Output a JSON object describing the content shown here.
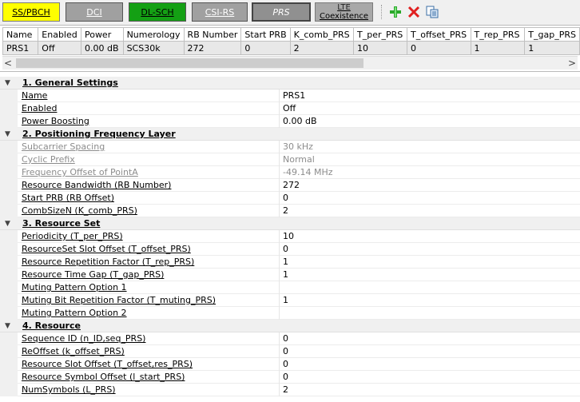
{
  "tabs": [
    {
      "label": "SS/PBCH"
    },
    {
      "label": "DCI"
    },
    {
      "label": "DL-SCH"
    },
    {
      "label": "CSI-RS"
    },
    {
      "label": "PRS"
    },
    {
      "label_line1": "LTE",
      "label_line2": "Coexistence"
    }
  ],
  "toolbar": {
    "add_icon": "add-plus-icon",
    "delete_icon": "delete-x-icon",
    "copy_icon": "copy-icon",
    "colors": {
      "add": "#2aa82a",
      "delete": "#e02020"
    }
  },
  "grid": {
    "columns": [
      "Name",
      "Enabled",
      "Power",
      "Numerology",
      "RB Number",
      "Start PRB",
      "K_comb_PRS",
      "T_per_PRS",
      "T_offset_PRS",
      "T_rep_PRS",
      "T_gap_PRS"
    ],
    "rows": [
      [
        "PRS1",
        "Off",
        "0.00 dB",
        "SCS30k",
        "272",
        "0",
        "2",
        "10",
        "0",
        "1",
        "1"
      ]
    ],
    "scroll_left": "<",
    "scroll_right": ">"
  },
  "sections": [
    {
      "title": "1. General Settings",
      "toggle": "▼",
      "props": [
        {
          "name": "Name",
          "value": "PRS1",
          "disabled": false
        },
        {
          "name": "Enabled",
          "value": "Off",
          "disabled": false
        },
        {
          "name": "Power Boosting",
          "value": "0.00 dB",
          "disabled": false
        }
      ]
    },
    {
      "title": "2. Positioning Frequency Layer",
      "toggle": "▼",
      "props": [
        {
          "name": "Subcarrier Spacing",
          "value": "30 kHz",
          "disabled": true
        },
        {
          "name": "Cyclic Prefix",
          "value": "Normal",
          "disabled": true
        },
        {
          "name": "Frequency Offset of PointA",
          "value": "-49.14 MHz",
          "disabled": true
        },
        {
          "name": "Resource Bandwidth (RB Number)",
          "value": "272",
          "disabled": false
        },
        {
          "name": "Start PRB (RB Offset)",
          "value": "0",
          "disabled": false
        },
        {
          "name": "CombSizeN (K_comb_PRS)",
          "value": "2",
          "disabled": false
        }
      ]
    },
    {
      "title": "3. Resource Set",
      "toggle": "▼",
      "props": [
        {
          "name": "Periodicity (T_per_PRS)",
          "value": "10",
          "disabled": false
        },
        {
          "name": "ResourceSet Slot Offset (T_offset_PRS)",
          "value": "0",
          "disabled": false
        },
        {
          "name": "Resource Repetition Factor (T_rep_PRS)",
          "value": "1",
          "disabled": false
        },
        {
          "name": "Resource Time Gap (T_gap_PRS)",
          "value": "1",
          "disabled": false
        },
        {
          "name": "Muting Pattern Option 1",
          "value": "",
          "disabled": false
        },
        {
          "name": "Muting Bit Repetition Factor (T_muting_PRS)",
          "value": "1",
          "disabled": false
        },
        {
          "name": "Muting Pattern Option 2",
          "value": "",
          "disabled": false
        }
      ]
    },
    {
      "title": "4. Resource",
      "toggle": "▼",
      "props": [
        {
          "name": "Sequence ID (n_ID,seq_PRS)",
          "value": "0",
          "disabled": false
        },
        {
          "name": "ReOffset (k_offset_PRS)",
          "value": "0",
          "disabled": false
        },
        {
          "name": "Resource Slot Offset (T_offset,res_PRS)",
          "value": "0",
          "disabled": false
        },
        {
          "name": "Resource Symbol Offset (l_start_PRS)",
          "value": "0",
          "disabled": false
        },
        {
          "name": "NumSymbols (L_PRS)",
          "value": "2",
          "disabled": false
        }
      ]
    }
  ]
}
